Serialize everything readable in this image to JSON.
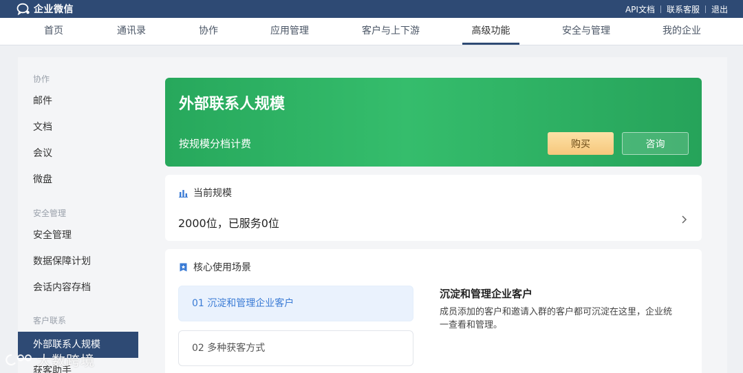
{
  "brand": {
    "name": "企业微信"
  },
  "top_links": {
    "api_docs": "API文档",
    "support": "联系客服",
    "logout": "退出"
  },
  "nav": {
    "items": [
      "首页",
      "通讯录",
      "协作",
      "应用管理",
      "客户与上下游",
      "高级功能",
      "安全与管理",
      "我的企业"
    ],
    "active": "高级功能"
  },
  "sidebar": {
    "group_collab": "协作",
    "collab_items": [
      "邮件",
      "文档",
      "会议",
      "微盘"
    ],
    "group_security": "安全管理",
    "security_items": [
      "安全管理",
      "数据保障计划",
      "会话内容存档"
    ],
    "group_customer": "客户联系",
    "customer_items": [
      "外部联系人规模",
      "获客助手"
    ],
    "active": "外部联系人规模"
  },
  "hero": {
    "title": "外部联系人规模",
    "subtitle": "按规模分档计费",
    "buy_label": "购买",
    "consult_label": "咨询",
    "gradient_start": "#27a85c",
    "gradient_end": "#26a35a"
  },
  "current_scale": {
    "header": "当前规模",
    "value": "2000位，已服务0位"
  },
  "scenarios": {
    "header": "核心使用场景",
    "items": [
      "01  沉淀和管理企业客户",
      "02  多种获客方式"
    ],
    "detail_title": "沉淀和管理企业客户",
    "detail_desc": "成员添加的客户和邀请入群的客户都可沉淀在这里，企业统一查看和管理。"
  },
  "watermark": {
    "text": "大数跨境"
  },
  "colors": {
    "topbar": "#2e4a74",
    "accent_blue": "#3a7bd5",
    "green": "#2fb466",
    "buy_gold": "#f6c77c"
  }
}
